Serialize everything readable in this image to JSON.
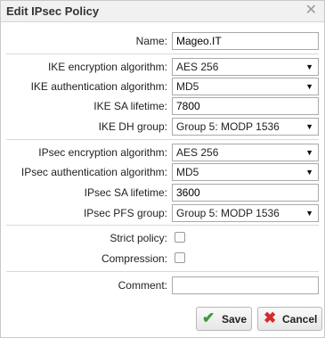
{
  "dialog": {
    "title": "Edit IPsec Policy",
    "close_icon": "close-icon"
  },
  "form": {
    "name": {
      "label": "Name:",
      "value": "Mageo.IT"
    },
    "ike_enc": {
      "label": "IKE encryption algorithm:",
      "value": "AES 256"
    },
    "ike_auth": {
      "label": "IKE authentication algorithm:",
      "value": "MD5"
    },
    "ike_sa_lifetime": {
      "label": "IKE SA lifetime:",
      "value": "7800"
    },
    "ike_dh": {
      "label": "IKE DH group:",
      "value": "Group 5: MODP 1536"
    },
    "ipsec_enc": {
      "label": "IPsec encryption algorithm:",
      "value": "AES 256"
    },
    "ipsec_auth": {
      "label": "IPsec authentication algorithm:",
      "value": "MD5"
    },
    "ipsec_sa_lifetime": {
      "label": "IPsec SA lifetime:",
      "value": "3600"
    },
    "ipsec_pfs": {
      "label": "IPsec PFS group:",
      "value": "Group 5: MODP 1536"
    },
    "strict_policy": {
      "label": "Strict policy:",
      "checked": false
    },
    "compression": {
      "label": "Compression:",
      "checked": false
    },
    "comment": {
      "label": "Comment:",
      "value": ""
    }
  },
  "buttons": {
    "save": "Save",
    "cancel": "Cancel"
  },
  "colors": {
    "save_check": "#3a9a3a",
    "cancel_x": "#d62a2a"
  }
}
